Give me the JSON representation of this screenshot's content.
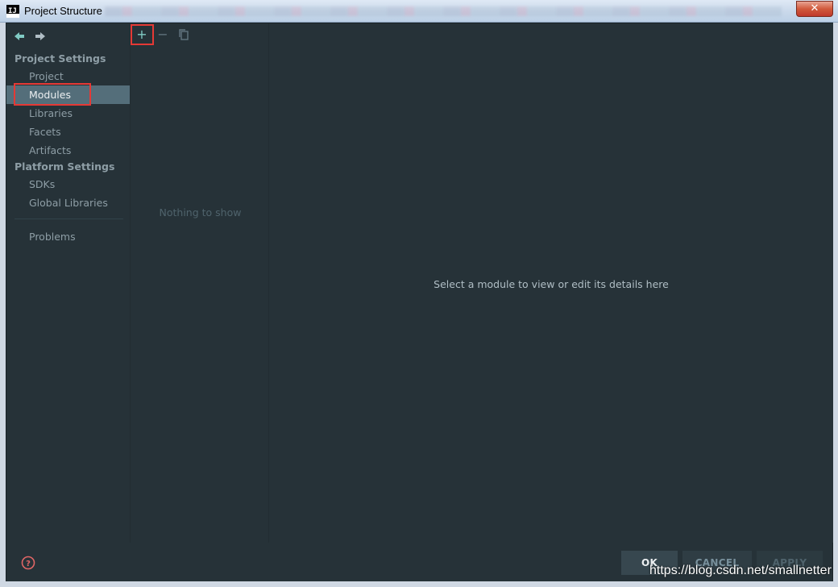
{
  "window": {
    "title": "Project Structure",
    "app_icon_label": "IJ",
    "close_label": "✕"
  },
  "nav": {
    "back_icon": "back-arrow-icon",
    "forward_icon": "forward-arrow-icon",
    "project_settings_heading": "Project Settings",
    "platform_settings_heading": "Platform Settings",
    "items": [
      {
        "label": "Project"
      },
      {
        "label": "Modules",
        "selected": true
      },
      {
        "label": "Libraries"
      },
      {
        "label": "Facets"
      },
      {
        "label": "Artifacts"
      },
      {
        "label": "SDKs"
      },
      {
        "label": "Global Libraries"
      },
      {
        "label": "Problems"
      }
    ]
  },
  "list_panel": {
    "add_label": "+",
    "remove_label": "−",
    "empty_text": "Nothing to show"
  },
  "detail_panel": {
    "empty_text": "Select a module to view or edit its details here"
  },
  "buttons": {
    "ok": "OK",
    "cancel": "CANCEL",
    "apply": "APPLY"
  },
  "watermark": "https://blog.csdn.net/smallnetter",
  "colors": {
    "background": "#263238",
    "selection": "#546e7a",
    "accent": "#80cbc4",
    "highlight": "#e53935"
  }
}
